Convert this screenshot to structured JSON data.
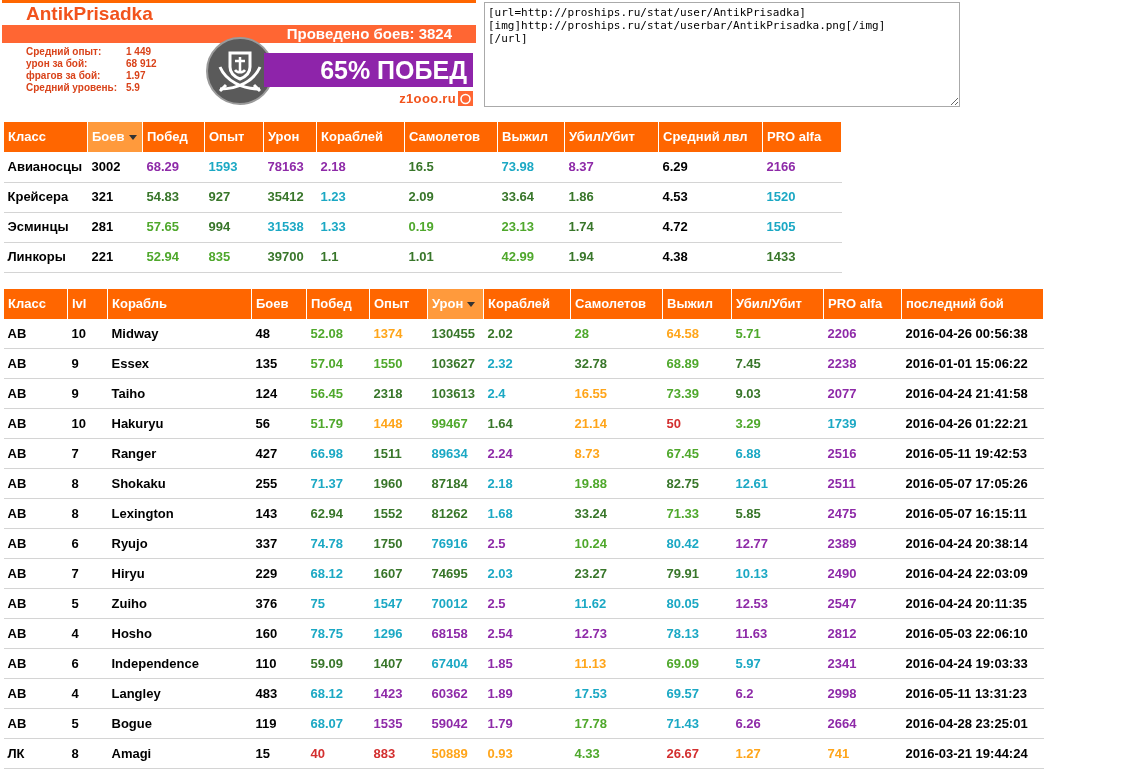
{
  "player": {
    "name": "AntikPrisadka",
    "battles": "Проведено боев: 3824",
    "stats": [
      {
        "label": "Средний опыт:",
        "value": "1 449"
      },
      {
        "label": "урон за бой:",
        "value": "68 912"
      },
      {
        "label": "фрагов за бой:",
        "value": "1.97"
      },
      {
        "label": "Средний уровень:",
        "value": "5.9"
      }
    ],
    "win_rate": "65% ПОБЕД",
    "site": "z1ooo.ru"
  },
  "bbcode": {
    "value": "[url=http://proships.ru/stat/user/AntikPrisadka]\n[img]http://proships.ru/stat/userbar/AntikPrisadka.png[/img]\n[/url]"
  },
  "class_table": {
    "columns": [
      {
        "label": "Класс",
        "selected": false
      },
      {
        "label": "Боев",
        "selected": true
      },
      {
        "label": "Побед",
        "selected": false
      },
      {
        "label": "Опыт",
        "selected": false
      },
      {
        "label": "Урон",
        "selected": false
      },
      {
        "label": "Кораблей",
        "selected": false
      },
      {
        "label": "Самолетов",
        "selected": false
      },
      {
        "label": "Выжил",
        "selected": false
      },
      {
        "label": "Убил/Убит",
        "selected": false
      },
      {
        "label": "Средний лвл",
        "selected": false
      },
      {
        "label": "PRO alfa",
        "selected": false
      }
    ],
    "rows": [
      {
        "cells": [
          "Авианосцы",
          "3002",
          {
            "text": "68.29",
            "color": "#8e2aa8"
          },
          {
            "text": "1593",
            "color": "#1ba8c4"
          },
          {
            "text": "78163",
            "color": "#8e2aa8"
          },
          {
            "text": "2.18",
            "color": "#8e2aa8"
          },
          {
            "text": "16.5",
            "color": "#38762a"
          },
          {
            "text": "73.98",
            "color": "#1ba8c4"
          },
          {
            "text": "8.37",
            "color": "#8e2aa8"
          },
          "6.29",
          {
            "text": "2166",
            "color": "#8e2aa8"
          }
        ]
      },
      {
        "cells": [
          "Крейсера",
          "321",
          {
            "text": "54.83",
            "color": "#38762a"
          },
          {
            "text": "927",
            "color": "#38762a"
          },
          {
            "text": "35412",
            "color": "#38762a"
          },
          {
            "text": "1.23",
            "color": "#1ba8c4"
          },
          {
            "text": "2.09",
            "color": "#38762a"
          },
          {
            "text": "33.64",
            "color": "#38762a"
          },
          {
            "text": "1.86",
            "color": "#38762a"
          },
          "4.53",
          {
            "text": "1520",
            "color": "#1ba8c4"
          }
        ]
      },
      {
        "cells": [
          "Эсминцы",
          "281",
          {
            "text": "57.65",
            "color": "#4fa82c"
          },
          {
            "text": "994",
            "color": "#38762a"
          },
          {
            "text": "31538",
            "color": "#1ba8c4"
          },
          {
            "text": "1.33",
            "color": "#1ba8c4"
          },
          {
            "text": "0.19",
            "color": "#4fa82c"
          },
          {
            "text": "23.13",
            "color": "#4fa82c"
          },
          {
            "text": "1.74",
            "color": "#38762a"
          },
          "4.72",
          {
            "text": "1505",
            "color": "#1ba8c4"
          }
        ]
      },
      {
        "cells": [
          "Линкоры",
          "221",
          {
            "text": "52.94",
            "color": "#4fa82c"
          },
          {
            "text": "835",
            "color": "#4fa82c"
          },
          {
            "text": "39700",
            "color": "#38762a"
          },
          {
            "text": "1.1",
            "color": "#38762a"
          },
          {
            "text": "1.01",
            "color": "#38762a"
          },
          {
            "text": "42.99",
            "color": "#4fa82c"
          },
          {
            "text": "1.94",
            "color": "#38762a"
          },
          "4.38",
          {
            "text": "1433",
            "color": "#38762a"
          }
        ]
      }
    ]
  },
  "ship_table": {
    "columns": [
      {
        "label": "Класс",
        "selected": false
      },
      {
        "label": "lvl",
        "selected": false
      },
      {
        "label": "Корабль",
        "selected": false
      },
      {
        "label": "Боев",
        "selected": false
      },
      {
        "label": "Побед",
        "selected": false
      },
      {
        "label": "Опыт",
        "selected": false
      },
      {
        "label": "Урон",
        "selected": true
      },
      {
        "label": "Кораблей",
        "selected": false
      },
      {
        "label": "Самолетов",
        "selected": false
      },
      {
        "label": "Выжил",
        "selected": false
      },
      {
        "label": "Убил/Убит",
        "selected": false
      },
      {
        "label": "PRO alfa",
        "selected": false
      },
      {
        "label": "последний бой",
        "selected": false
      }
    ],
    "rows": [
      {
        "cells": [
          "АВ",
          "10",
          "Midway",
          "48",
          {
            "text": "52.08",
            "color": "#4fa82c"
          },
          {
            "text": "1374",
            "color": "#ffa51a"
          },
          {
            "text": "130455",
            "color": "#38762a"
          },
          {
            "text": "2.02",
            "color": "#38762a"
          },
          {
            "text": "28",
            "color": "#4fa82c"
          },
          {
            "text": "64.58",
            "color": "#ffa51a"
          },
          {
            "text": "5.71",
            "color": "#4fa82c"
          },
          {
            "text": "2206",
            "color": "#8e2aa8"
          },
          "2016-04-26 00:56:38"
        ]
      },
      {
        "cells": [
          "АВ",
          "9",
          "Essex",
          "135",
          {
            "text": "57.04",
            "color": "#4fa82c"
          },
          {
            "text": "1550",
            "color": "#4fa82c"
          },
          {
            "text": "103627",
            "color": "#38762a"
          },
          {
            "text": "2.32",
            "color": "#1ba8c4"
          },
          {
            "text": "32.78",
            "color": "#38762a"
          },
          {
            "text": "68.89",
            "color": "#4fa82c"
          },
          {
            "text": "7.45",
            "color": "#38762a"
          },
          {
            "text": "2238",
            "color": "#8e2aa8"
          },
          "2016-01-01 15:06:22"
        ]
      },
      {
        "cells": [
          "АВ",
          "9",
          "Taiho",
          "124",
          {
            "text": "56.45",
            "color": "#4fa82c"
          },
          {
            "text": "2318",
            "color": "#38762a"
          },
          {
            "text": "103613",
            "color": "#38762a"
          },
          {
            "text": "2.4",
            "color": "#1ba8c4"
          },
          {
            "text": "16.55",
            "color": "#ffa51a"
          },
          {
            "text": "73.39",
            "color": "#4fa82c"
          },
          {
            "text": "9.03",
            "color": "#38762a"
          },
          {
            "text": "2077",
            "color": "#8e2aa8"
          },
          "2016-04-24 21:41:58"
        ]
      },
      {
        "cells": [
          "АВ",
          "10",
          "Hakuryu",
          "56",
          {
            "text": "51.79",
            "color": "#4fa82c"
          },
          {
            "text": "1448",
            "color": "#ffa51a"
          },
          {
            "text": "99467",
            "color": "#4fa82c"
          },
          {
            "text": "1.64",
            "color": "#38762a"
          },
          {
            "text": "21.14",
            "color": "#ffa51a"
          },
          {
            "text": "50",
            "color": "#d32f2f"
          },
          {
            "text": "3.29",
            "color": "#4fa82c"
          },
          {
            "text": "1739",
            "color": "#1ba8c4"
          },
          "2016-04-26 01:22:21"
        ]
      },
      {
        "cells": [
          "АВ",
          "7",
          "Ranger",
          "427",
          {
            "text": "66.98",
            "color": "#1ba8c4"
          },
          {
            "text": "1511",
            "color": "#38762a"
          },
          {
            "text": "89634",
            "color": "#1ba8c4"
          },
          {
            "text": "2.24",
            "color": "#8e2aa8"
          },
          {
            "text": "8.73",
            "color": "#ffa51a"
          },
          {
            "text": "67.45",
            "color": "#4fa82c"
          },
          {
            "text": "6.88",
            "color": "#1ba8c4"
          },
          {
            "text": "2516",
            "color": "#8e2aa8"
          },
          "2016-05-11 19:42:53"
        ]
      },
      {
        "cells": [
          "АВ",
          "8",
          "Shokaku",
          "255",
          {
            "text": "71.37",
            "color": "#1ba8c4"
          },
          {
            "text": "1960",
            "color": "#38762a"
          },
          {
            "text": "87184",
            "color": "#38762a"
          },
          {
            "text": "2.18",
            "color": "#1ba8c4"
          },
          {
            "text": "19.88",
            "color": "#4fa82c"
          },
          {
            "text": "82.75",
            "color": "#38762a"
          },
          {
            "text": "12.61",
            "color": "#1ba8c4"
          },
          {
            "text": "2511",
            "color": "#8e2aa8"
          },
          "2016-05-07 17:05:26"
        ]
      },
      {
        "cells": [
          "АВ",
          "8",
          "Lexington",
          "143",
          {
            "text": "62.94",
            "color": "#38762a"
          },
          {
            "text": "1552",
            "color": "#38762a"
          },
          {
            "text": "81262",
            "color": "#38762a"
          },
          {
            "text": "1.68",
            "color": "#1ba8c4"
          },
          {
            "text": "33.24",
            "color": "#38762a"
          },
          {
            "text": "71.33",
            "color": "#4fa82c"
          },
          {
            "text": "5.85",
            "color": "#38762a"
          },
          {
            "text": "2475",
            "color": "#8e2aa8"
          },
          "2016-05-07 16:15:11"
        ]
      },
      {
        "cells": [
          "АВ",
          "6",
          "Ryujo",
          "337",
          {
            "text": "74.78",
            "color": "#1ba8c4"
          },
          {
            "text": "1750",
            "color": "#38762a"
          },
          {
            "text": "76916",
            "color": "#1ba8c4"
          },
          {
            "text": "2.5",
            "color": "#8e2aa8"
          },
          {
            "text": "10.24",
            "color": "#4fa82c"
          },
          {
            "text": "80.42",
            "color": "#1ba8c4"
          },
          {
            "text": "12.77",
            "color": "#8e2aa8"
          },
          {
            "text": "2389",
            "color": "#8e2aa8"
          },
          "2016-04-24 20:38:14"
        ]
      },
      {
        "cells": [
          "АВ",
          "7",
          "Hiryu",
          "229",
          {
            "text": "68.12",
            "color": "#1ba8c4"
          },
          {
            "text": "1607",
            "color": "#38762a"
          },
          {
            "text": "74695",
            "color": "#38762a"
          },
          {
            "text": "2.03",
            "color": "#1ba8c4"
          },
          {
            "text": "23.27",
            "color": "#38762a"
          },
          {
            "text": "79.91",
            "color": "#38762a"
          },
          {
            "text": "10.13",
            "color": "#1ba8c4"
          },
          {
            "text": "2490",
            "color": "#8e2aa8"
          },
          "2016-04-24 22:03:09"
        ]
      },
      {
        "cells": [
          "АВ",
          "5",
          "Zuiho",
          "376",
          {
            "text": "75",
            "color": "#1ba8c4"
          },
          {
            "text": "1547",
            "color": "#1ba8c4"
          },
          {
            "text": "70012",
            "color": "#1ba8c4"
          },
          {
            "text": "2.5",
            "color": "#8e2aa8"
          },
          {
            "text": "11.62",
            "color": "#1ba8c4"
          },
          {
            "text": "80.05",
            "color": "#1ba8c4"
          },
          {
            "text": "12.53",
            "color": "#8e2aa8"
          },
          {
            "text": "2547",
            "color": "#8e2aa8"
          },
          "2016-04-24 20:11:35"
        ]
      },
      {
        "cells": [
          "АВ",
          "4",
          "Hosho",
          "160",
          {
            "text": "78.75",
            "color": "#1ba8c4"
          },
          {
            "text": "1296",
            "color": "#1ba8c4"
          },
          {
            "text": "68158",
            "color": "#8e2aa8"
          },
          {
            "text": "2.54",
            "color": "#8e2aa8"
          },
          {
            "text": "12.73",
            "color": "#8e2aa8"
          },
          {
            "text": "78.13",
            "color": "#1ba8c4"
          },
          {
            "text": "11.63",
            "color": "#8e2aa8"
          },
          {
            "text": "2812",
            "color": "#8e2aa8"
          },
          "2016-05-03 22:06:10"
        ]
      },
      {
        "cells": [
          "АВ",
          "6",
          "Independence",
          "110",
          {
            "text": "59.09",
            "color": "#38762a"
          },
          {
            "text": "1407",
            "color": "#38762a"
          },
          {
            "text": "67404",
            "color": "#1ba8c4"
          },
          {
            "text": "1.85",
            "color": "#8e2aa8"
          },
          {
            "text": "11.13",
            "color": "#ffa51a"
          },
          {
            "text": "69.09",
            "color": "#4fa82c"
          },
          {
            "text": "5.97",
            "color": "#1ba8c4"
          },
          {
            "text": "2341",
            "color": "#8e2aa8"
          },
          "2016-04-24 19:03:33"
        ]
      },
      {
        "cells": [
          "АВ",
          "4",
          "Langley",
          "483",
          {
            "text": "68.12",
            "color": "#1ba8c4"
          },
          {
            "text": "1423",
            "color": "#8e2aa8"
          },
          {
            "text": "60362",
            "color": "#8e2aa8"
          },
          {
            "text": "1.89",
            "color": "#8e2aa8"
          },
          {
            "text": "17.53",
            "color": "#1ba8c4"
          },
          {
            "text": "69.57",
            "color": "#1ba8c4"
          },
          {
            "text": "6.2",
            "color": "#8e2aa8"
          },
          {
            "text": "2998",
            "color": "#8e2aa8"
          },
          "2016-05-11 13:31:23"
        ]
      },
      {
        "cells": [
          "АВ",
          "5",
          "Bogue",
          "119",
          {
            "text": "68.07",
            "color": "#1ba8c4"
          },
          {
            "text": "1535",
            "color": "#8e2aa8"
          },
          {
            "text": "59042",
            "color": "#8e2aa8"
          },
          {
            "text": "1.79",
            "color": "#8e2aa8"
          },
          {
            "text": "17.78",
            "color": "#4fa82c"
          },
          {
            "text": "71.43",
            "color": "#1ba8c4"
          },
          {
            "text": "6.26",
            "color": "#8e2aa8"
          },
          {
            "text": "2664",
            "color": "#8e2aa8"
          },
          "2016-04-28 23:25:01"
        ]
      },
      {
        "cells": [
          "ЛК",
          "8",
          "Amagi",
          "15",
          {
            "text": "40",
            "color": "#d32f2f"
          },
          {
            "text": "883",
            "color": "#d32f2f"
          },
          {
            "text": "50889",
            "color": "#ffa51a"
          },
          {
            "text": "0.93",
            "color": "#ffa51a"
          },
          {
            "text": "4.33",
            "color": "#4fa82c"
          },
          {
            "text": "26.67",
            "color": "#d32f2f"
          },
          {
            "text": "1.27",
            "color": "#ffa51a"
          },
          {
            "text": "741",
            "color": "#ffa51a"
          },
          "2016-03-21 19:44:24"
        ]
      }
    ]
  }
}
